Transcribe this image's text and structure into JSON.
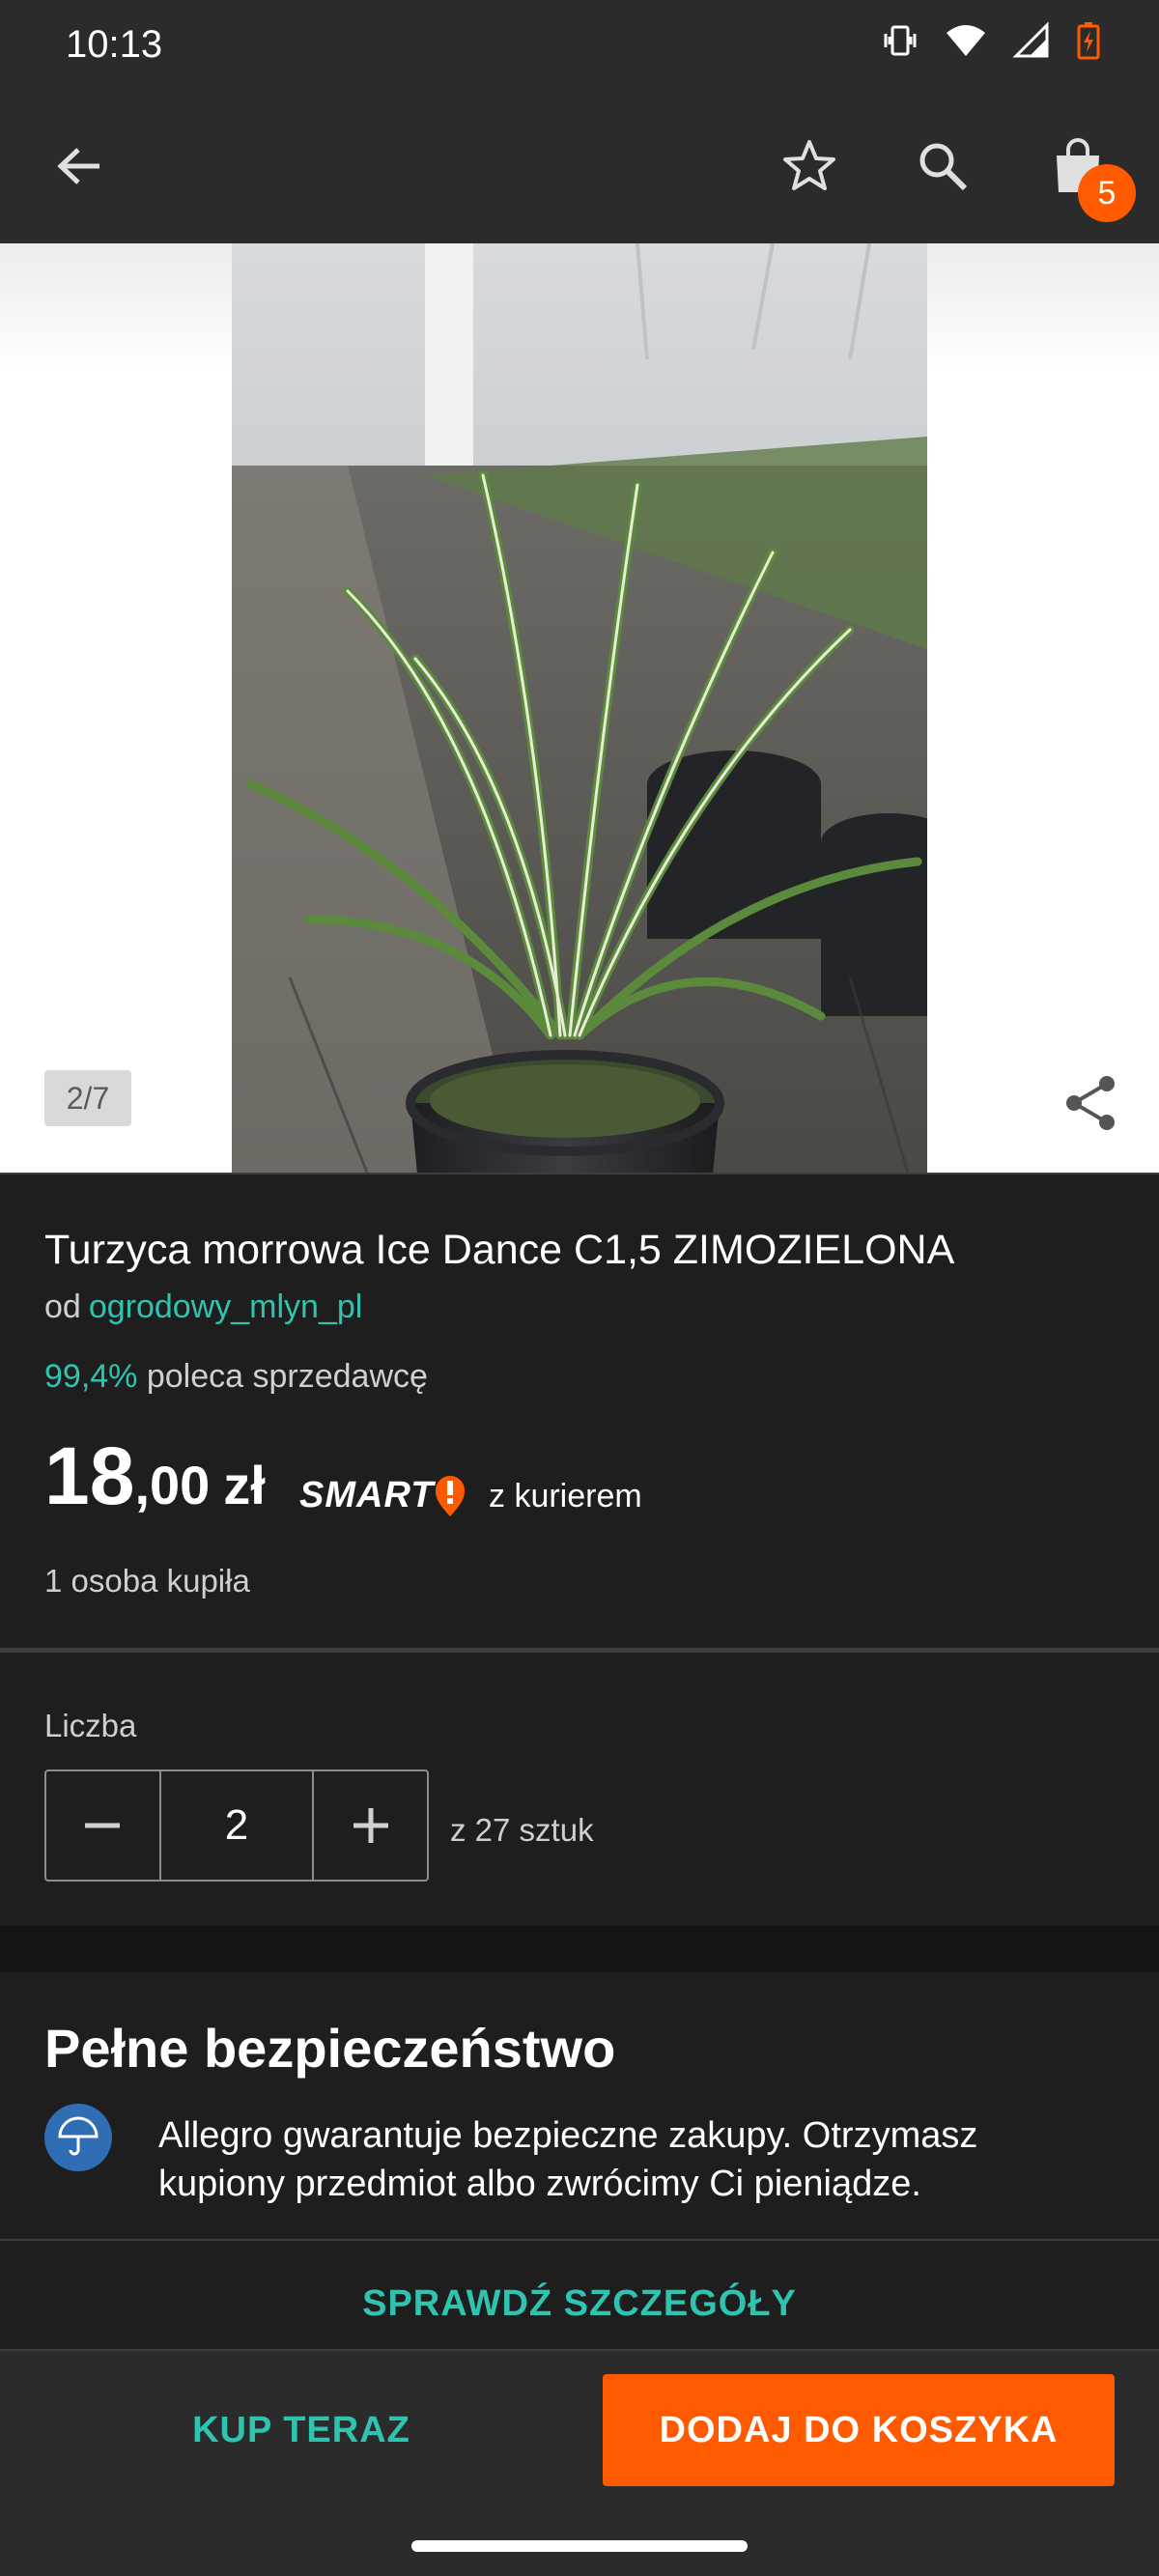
{
  "status_bar": {
    "time": "10:13",
    "icons": [
      "vibrate-icon",
      "wifi-icon",
      "signal-icon",
      "battery-icon"
    ],
    "battery_color": "#ff5a00"
  },
  "app_bar": {
    "icons": [
      "back-arrow-icon",
      "star-icon",
      "search-icon",
      "shopping-bag-icon"
    ],
    "cart_count": "5",
    "badge_color": "#ff5a00"
  },
  "gallery": {
    "counter": "2/7",
    "share_icon": "share-icon",
    "image_alt": "potted variegated sedge plant in a greenhouse"
  },
  "product": {
    "title": "Turzyca morrowa Ice Dance C1,5 ZIMOZIELONA",
    "seller_prefix": "od",
    "seller_name": "ogrodowy_mlyn_pl",
    "rating_value": "99,4%",
    "rating_text": "poleca sprzedawcę",
    "price_int": "18",
    "price_dec": ",00",
    "price_currency": "zł",
    "smart_label": "SMART",
    "delivery_text": "z kurierem",
    "bought_text": "1 osoba kupiła"
  },
  "quantity": {
    "label": "Liczba",
    "value": "2",
    "available": "z 27 sztuk"
  },
  "security": {
    "title": "Pełne bezpieczeństwo",
    "icon": "umbrella-icon",
    "text": "Allegro gwarantuje bezpieczne zakupy. Otrzymasz kupiony przedmiot albo zwrócimy Ci pieniądze.",
    "link": "SPRAWDŹ SZCZEGÓŁY"
  },
  "actions": {
    "buy_now": "KUP TERAZ",
    "add_to_cart": "DODAJ DO KOSZYKA"
  },
  "colors": {
    "accent_teal": "#2fc4b0",
    "accent_orange": "#ff5a00",
    "background": "#1e1e1e",
    "surface": "#2b2b2b"
  }
}
